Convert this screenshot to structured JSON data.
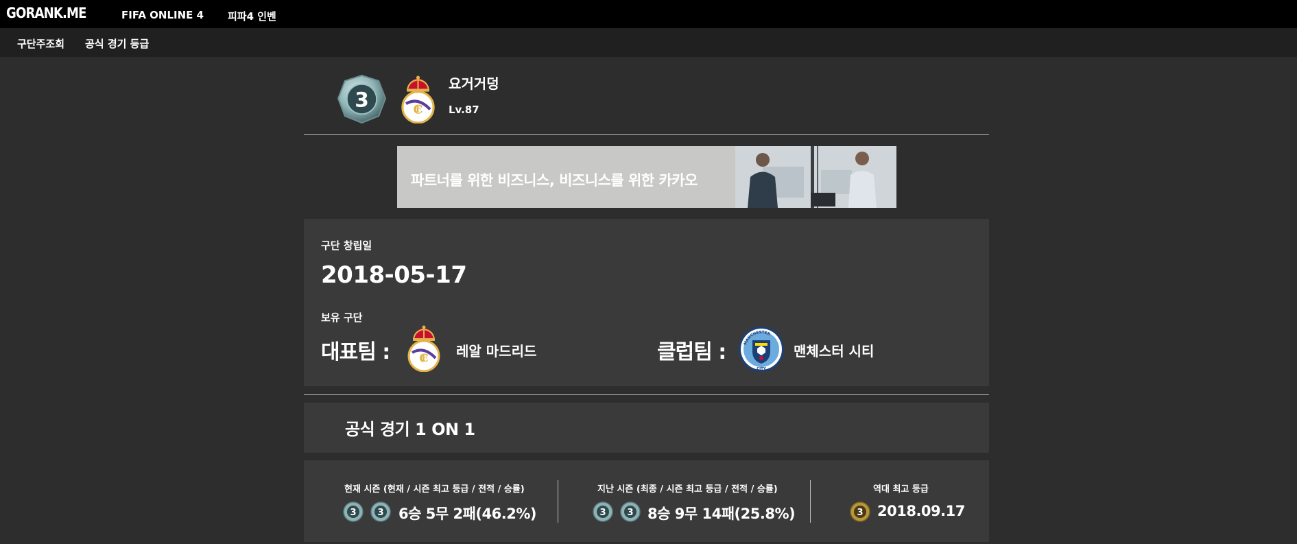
{
  "topbar": {
    "logo": "GORANK.ME",
    "nav": [
      "FIFA ONLINE 4",
      "피파4 인벤"
    ]
  },
  "subnav": [
    "구단주조회",
    "공식 경기 등급"
  ],
  "profile": {
    "rank_badge_number": "3",
    "crest_icon": "real-madrid-crest-icon",
    "name": "요거거덩",
    "level": "Lv.87"
  },
  "ad": {
    "text": "파트너를 위한 비즈니스, 비즈니스를 위한 카카오"
  },
  "club_info": {
    "founded_label": "구단 창립일",
    "founded_date": "2018-05-17",
    "owned_label": "보유 구단",
    "main_team_label": "대표팀 :",
    "main_team_name": "레알 마드리드",
    "main_team_icon": "real-madrid-crest-icon",
    "club_team_label": "클럽팀 :",
    "club_team_name": "맨체스터 시티",
    "club_team_icon": "manchester-city-crest-icon"
  },
  "match": {
    "title": "공식 경기 1 ON 1",
    "current_season": {
      "header": "현재 시즌 (현재 / 시즌 최고 등급 / 전적 / 승률)",
      "record": "6승 5무 2패(46.2%)"
    },
    "last_season": {
      "header": "지난 시즌 (최종 / 시즌 최고 등급 / 전적 / 승률)",
      "record": "8승 9무 14패(25.8%)"
    },
    "all_time": {
      "header": "역대 최고 등급",
      "date": "2018.09.17"
    }
  },
  "colors": {
    "background": "#2d2d2d",
    "topbar": "#000000",
    "subbar": "#202020",
    "panel": "#3a3a3a",
    "ad_background": "#c8c9c7"
  }
}
